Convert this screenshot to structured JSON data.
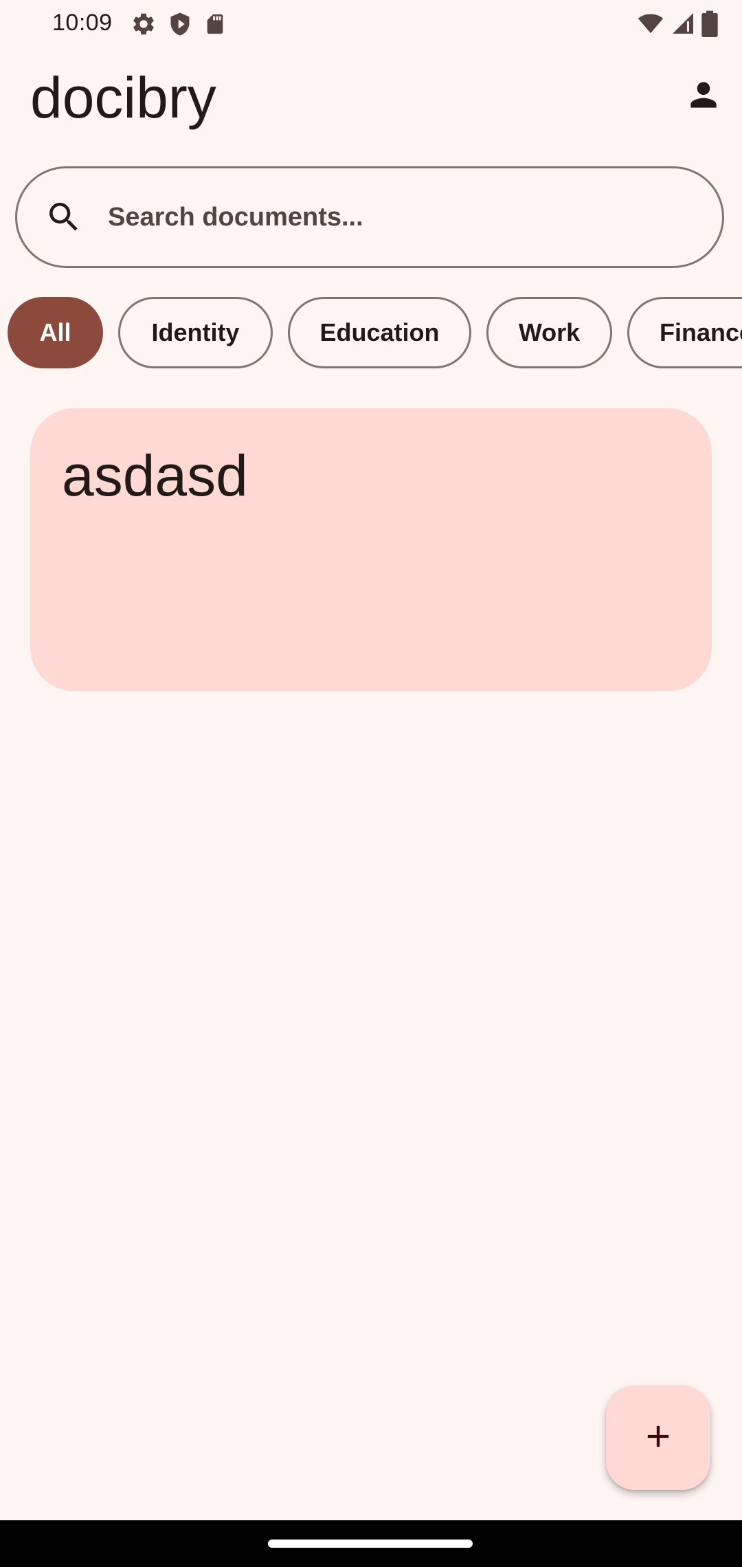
{
  "status_bar": {
    "time": "10:09",
    "left_icons": [
      "settings-icon",
      "shield-icon",
      "sd-card-icon"
    ],
    "right_icons": [
      "wifi-icon",
      "cellular-signal-icon",
      "battery-icon"
    ]
  },
  "app_bar": {
    "title": "docibry",
    "profile_icon": "person-icon"
  },
  "search": {
    "placeholder": "Search documents...",
    "value": "",
    "icon": "search-icon"
  },
  "filters": {
    "chips": [
      {
        "label": "All",
        "selected": true
      },
      {
        "label": "Identity",
        "selected": false
      },
      {
        "label": "Education",
        "selected": false
      },
      {
        "label": "Work",
        "selected": false
      },
      {
        "label": "Finance",
        "selected": false
      }
    ]
  },
  "documents": [
    {
      "title": "asdasd"
    }
  ],
  "fab": {
    "icon": "plus-icon"
  },
  "colors": {
    "background": "#FFF5F3",
    "primary": "#8C4A3C",
    "card": "#FFDAD4",
    "outline": "#857370",
    "on_surface": "#231917"
  }
}
